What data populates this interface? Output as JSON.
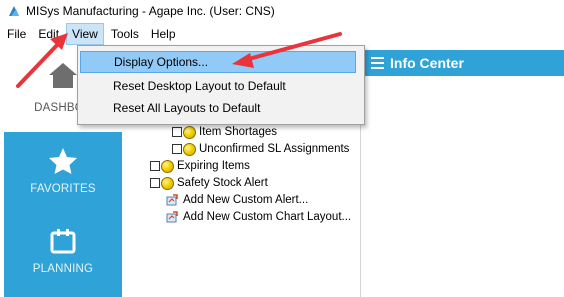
{
  "window": {
    "title": "MISys Manufacturing - Agape Inc. (User: CNS)"
  },
  "menubar": {
    "items": [
      "File",
      "Edit",
      "View",
      "Tools",
      "Help"
    ],
    "open_item": "View"
  },
  "view_menu": {
    "items": [
      {
        "label": "Display Options...",
        "highlighted": true
      },
      {
        "label": "Reset Desktop Layout to Default",
        "highlighted": false
      },
      {
        "label": "Reset All Layouts to Default",
        "highlighted": false
      }
    ]
  },
  "sidebar": {
    "items": [
      {
        "label": "DASHBOA",
        "icon": "home-icon"
      },
      {
        "label": "FAVORITES",
        "icon": "star-icon"
      },
      {
        "label": "PLANNING",
        "icon": "calendar-icon"
      }
    ],
    "accent_color": "#2fa3d8"
  },
  "tree": {
    "rows": [
      {
        "label": "Item Shortages",
        "type": "alert",
        "indent": 1
      },
      {
        "label": "Unconfirmed SL Assignments",
        "type": "alert",
        "indent": 1
      },
      {
        "label": "Expiring Items",
        "type": "alert",
        "indent": 0
      },
      {
        "label": "Safety Stock Alert",
        "type": "alert",
        "indent": 0
      },
      {
        "label": "Add New Custom Alert...",
        "type": "action",
        "indent": 0
      },
      {
        "label": "Add New Custom Chart Layout...",
        "type": "action",
        "indent": 0
      }
    ]
  },
  "info_center": {
    "title": "Info Center"
  },
  "annotation": {
    "arrow_color": "#e8343a"
  }
}
